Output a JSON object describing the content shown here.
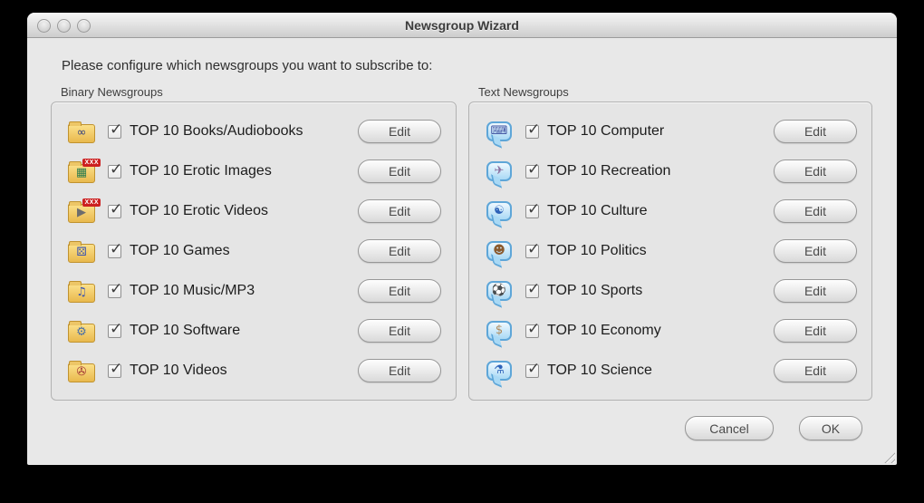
{
  "window": {
    "title": "Newsgroup Wizard",
    "subtitle": "Please configure which newsgroups you want to subscribe to:"
  },
  "edit_label": "Edit",
  "groups": [
    {
      "label": "Binary Newsgroups",
      "icon_type": "folder",
      "rows": [
        {
          "label": "TOP 10 Books/Audiobooks",
          "icon": "books-folder-icon",
          "glyph": "∞",
          "glyph_color": "#35407e",
          "badge": "",
          "checked": true
        },
        {
          "label": "TOP 10 Erotic Images",
          "icon": "erotic-images-folder-icon",
          "glyph": "▦",
          "glyph_color": "#2e7d4f",
          "badge": "XXX",
          "checked": true
        },
        {
          "label": "TOP 10 Erotic Videos",
          "icon": "erotic-videos-folder-icon",
          "glyph": "▶",
          "glyph_color": "#6d6d6d",
          "badge": "XXX",
          "checked": true
        },
        {
          "label": "TOP 10 Games",
          "icon": "games-folder-icon",
          "glyph": "⚄",
          "glyph_color": "#3b55b0",
          "badge": "",
          "checked": true
        },
        {
          "label": "TOP 10 Music/MP3",
          "icon": "music-folder-icon",
          "glyph": "♫",
          "glyph_color": "#3b55b0",
          "badge": "",
          "checked": true
        },
        {
          "label": "TOP 10 Software",
          "icon": "software-folder-icon",
          "glyph": "⚙",
          "glyph_color": "#4a6fa5",
          "badge": "",
          "checked": true
        },
        {
          "label": "TOP 10 Videos",
          "icon": "videos-folder-icon",
          "glyph": "✇",
          "glyph_color": "#a03434",
          "badge": "",
          "checked": true
        }
      ]
    },
    {
      "label": "Text Newsgroups",
      "icon_type": "bubble",
      "rows": [
        {
          "label": "TOP 10 Computer",
          "icon": "computer-bubble-icon",
          "glyph": "⌨",
          "glyph_color": "#3d4f9e",
          "badge": "",
          "checked": true
        },
        {
          "label": "TOP 10 Recreation",
          "icon": "recreation-bubble-icon",
          "glyph": "✈",
          "glyph_color": "#8a6f9e",
          "badge": "",
          "checked": true
        },
        {
          "label": "TOP 10 Culture",
          "icon": "culture-bubble-icon",
          "glyph": "☯",
          "glyph_color": "#2d62b8",
          "badge": "",
          "checked": true
        },
        {
          "label": "TOP 10 Politics",
          "icon": "politics-bubble-icon",
          "glyph": "☻",
          "glyph_color": "#8a5a2e",
          "badge": "",
          "checked": true
        },
        {
          "label": "TOP 10 Sports",
          "icon": "sports-bubble-icon",
          "glyph": "⚽",
          "glyph_color": "#44508e",
          "badge": "",
          "checked": true
        },
        {
          "label": "TOP 10 Economy",
          "icon": "economy-bubble-icon",
          "glyph": "$",
          "glyph_color": "#b08a5a",
          "badge": "",
          "checked": true
        },
        {
          "label": "TOP 10 Science",
          "icon": "science-bubble-icon",
          "glyph": "⚗",
          "glyph_color": "#2d62b8",
          "badge": "",
          "checked": true
        }
      ]
    }
  ],
  "footer": {
    "cancel_label": "Cancel",
    "ok_label": "OK"
  }
}
